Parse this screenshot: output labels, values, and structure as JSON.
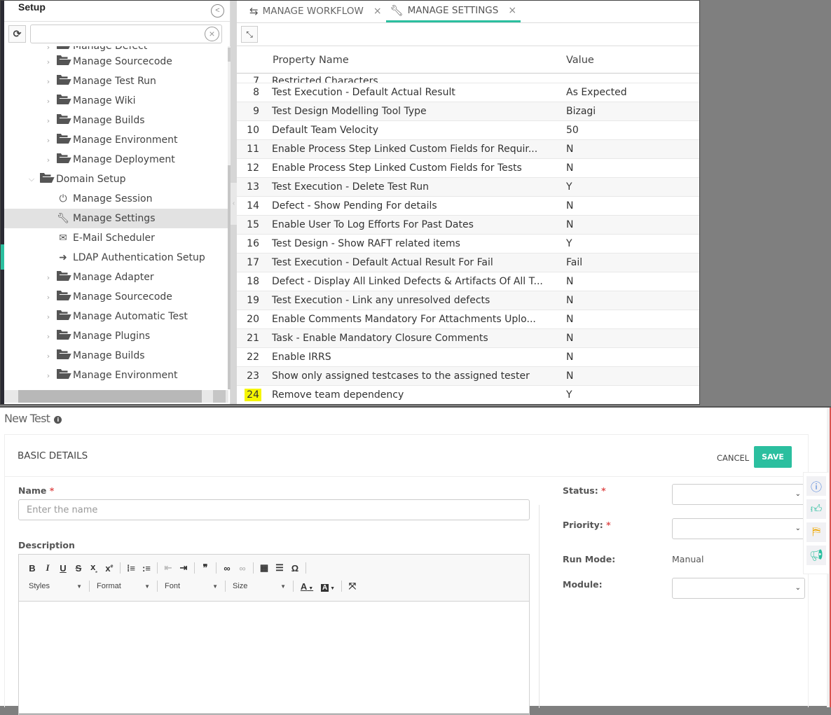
{
  "sidebar": {
    "title": "Setup",
    "collapse_icon": "chevron-left-circle-icon",
    "refresh_icon": "refresh-icon",
    "search_value": "",
    "clear_icon": "clear-circle-icon",
    "items": [
      {
        "label": "Manage Defect",
        "icon": "folder-icon",
        "level": 1,
        "expander": "chevron-right",
        "partial": true
      },
      {
        "label": "Manage Sourcecode",
        "icon": "folder-icon",
        "level": 1,
        "expander": "chevron-right"
      },
      {
        "label": "Manage Test Run",
        "icon": "folder-icon",
        "level": 1,
        "expander": "chevron-right"
      },
      {
        "label": "Manage Wiki",
        "icon": "folder-icon",
        "level": 1,
        "expander": "chevron-right"
      },
      {
        "label": "Manage Builds",
        "icon": "folder-icon",
        "level": 1,
        "expander": "chevron-right"
      },
      {
        "label": "Manage Environment",
        "icon": "folder-icon",
        "level": 1,
        "expander": "chevron-right"
      },
      {
        "label": "Manage Deployment",
        "icon": "folder-icon",
        "level": 1,
        "expander": "chevron-right"
      },
      {
        "label": "Domain Setup",
        "icon": "folder-open-icon",
        "level": 0,
        "expander": "chevron-down"
      },
      {
        "label": "Manage Session",
        "icon": "power-icon",
        "level": 2,
        "expander": ""
      },
      {
        "label": "Manage Settings",
        "icon": "wrench-icon",
        "level": 2,
        "expander": "",
        "selected": true
      },
      {
        "label": "E-Mail Scheduler",
        "icon": "envelope-icon",
        "level": 2,
        "expander": ""
      },
      {
        "label": "LDAP Authentication Setup",
        "icon": "sign-in-icon",
        "level": 2,
        "expander": ""
      },
      {
        "label": "Manage Adapter",
        "icon": "folder-icon",
        "level": 1,
        "expander": "chevron-right"
      },
      {
        "label": "Manage Sourcecode",
        "icon": "folder-icon",
        "level": 1,
        "expander": "chevron-right"
      },
      {
        "label": "Manage Automatic Test",
        "icon": "folder-icon",
        "level": 1,
        "expander": "chevron-right"
      },
      {
        "label": "Manage Plugins",
        "icon": "folder-icon",
        "level": 1,
        "expander": "chevron-right"
      },
      {
        "label": "Manage Builds",
        "icon": "folder-icon",
        "level": 1,
        "expander": "chevron-right"
      },
      {
        "label": "Manage Environment",
        "icon": "folder-icon",
        "level": 1,
        "expander": "chevron-right"
      }
    ]
  },
  "tabs": [
    {
      "label": "MANAGE WORKFLOW",
      "icon": "workflow-icon",
      "active": false,
      "close": "×"
    },
    {
      "label": "MANAGE SETTINGS",
      "icon": "wrench-icon",
      "active": true,
      "close": "×"
    }
  ],
  "toolbar": {
    "collapse_icon": "compress-icon"
  },
  "grid": {
    "columns": [
      "Property Name",
      "Value"
    ],
    "rows": [
      {
        "num": "7",
        "name": "Restricted Characters",
        "value": "",
        "partial": true
      },
      {
        "num": "8",
        "name": "Test Execution - Default Actual Result",
        "value": "As Expected"
      },
      {
        "num": "9",
        "name": "Test Design Modelling Tool Type",
        "value": "Bizagi"
      },
      {
        "num": "10",
        "name": "Default Team Velocity",
        "value": "50"
      },
      {
        "num": "11",
        "name": "Enable Process Step Linked Custom Fields for Requir...",
        "value": "N"
      },
      {
        "num": "12",
        "name": "Enable Process Step Linked Custom Fields for Tests",
        "value": "N"
      },
      {
        "num": "13",
        "name": "Test Execution - Delete Test Run",
        "value": "Y"
      },
      {
        "num": "14",
        "name": "Defect - Show Pending For details",
        "value": "N"
      },
      {
        "num": "15",
        "name": "Enable User To Log Efforts For Past Dates",
        "value": "N"
      },
      {
        "num": "16",
        "name": "Test Design - Show RAFT related items",
        "value": "Y"
      },
      {
        "num": "17",
        "name": "Test Execution - Default Actual Result For Fail",
        "value": "Fail"
      },
      {
        "num": "18",
        "name": "Defect - Display All Linked Defects & Artifacts Of All T...",
        "value": "N"
      },
      {
        "num": "19",
        "name": "Test Execution - Link any unresolved defects",
        "value": "N"
      },
      {
        "num": "20",
        "name": "Enable Comments Mandatory For Attachments Uplo...",
        "value": "N"
      },
      {
        "num": "21",
        "name": "Task - Enable Mandatory Closure Comments",
        "value": "N"
      },
      {
        "num": "22",
        "name": "Enable IRRS",
        "value": "N"
      },
      {
        "num": "23",
        "name": "Show only assigned testcases to the assigned tester",
        "value": "N"
      },
      {
        "num": "24",
        "name": "Remove team dependency",
        "value": "Y",
        "highlight": true
      }
    ]
  },
  "new_test": {
    "title": "New Test",
    "info_icon": "info-icon",
    "section_title": "BASIC DETAILS",
    "cancel_label": "CANCEL",
    "save_label": "SAVE",
    "name_label": "Name",
    "required_mark": "*",
    "name_value": "",
    "name_placeholder": "Enter the name",
    "description_label": "Description",
    "editor_toolbar": {
      "row1": [
        "B",
        "I",
        "U",
        "S",
        "x₂",
        "x²",
        "|",
        "numbered-list",
        "bulleted-list",
        "|",
        "outdent",
        "indent",
        "|",
        "blockquote",
        "|",
        "link",
        "unlink",
        "|",
        "table",
        "horizontal-line",
        "Ω",
        "|"
      ],
      "combos": [
        "Styles",
        "Format",
        "Font",
        "Size"
      ],
      "text_color": "A",
      "bg_color": "A",
      "maximize_icon": "maximize-icon"
    },
    "status_label": "Status:",
    "status_value": "",
    "priority_label": "Priority:",
    "priority_value": "",
    "run_mode_label": "Run Mode:",
    "run_mode_value": "Manual",
    "module_label": "Module:",
    "module_value": ""
  },
  "floating_bar": [
    {
      "icon": "help-icon",
      "color": "#4a7fd8"
    },
    {
      "icon": "thumbs-up-icon",
      "color": "#2bbf9f"
    },
    {
      "icon": "signpost-icon",
      "color": "#f0a800"
    },
    {
      "icon": "megaphone-icon",
      "color": "#2bbf9f"
    }
  ],
  "colors": {
    "accent": "#2bbf9f",
    "highlight": "#f5f500",
    "required": "#e05050"
  }
}
